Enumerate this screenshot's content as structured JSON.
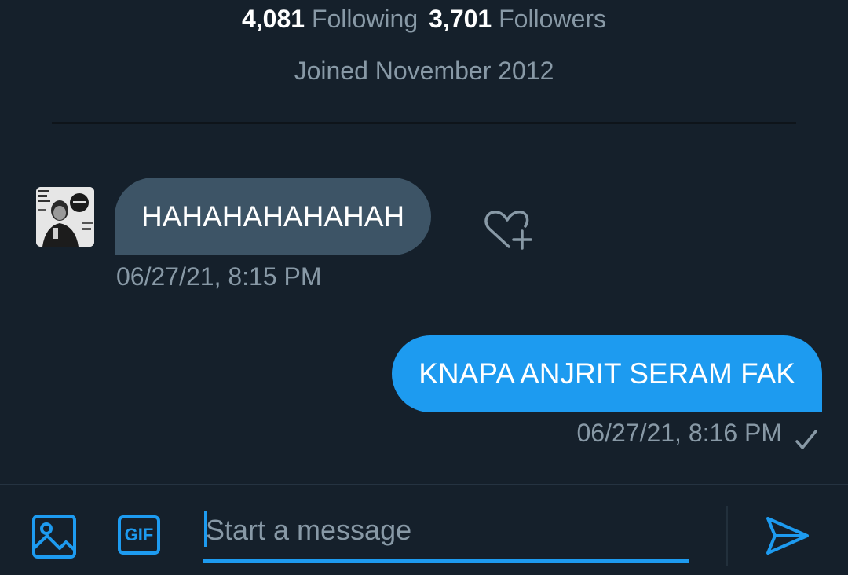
{
  "profile": {
    "following_count": "4,081",
    "following_label": "Following",
    "followers_count": "3,701",
    "followers_label": "Followers",
    "joined": "Joined November 2012"
  },
  "messages": [
    {
      "direction": "incoming",
      "text": "HAHAHAHAHAHAH",
      "time": "06/27/21, 8:15 PM"
    },
    {
      "direction": "outgoing",
      "text": "KNAPA ANJRIT SERAM FAK",
      "time": "06/27/21, 8:16 PM",
      "status_icon": "check-icon"
    }
  ],
  "composer": {
    "placeholder": "Start a message",
    "gif_label": "GIF",
    "icons": [
      "media-icon",
      "gif-icon",
      "send-icon"
    ]
  },
  "colors": {
    "background": "#15202b",
    "accent": "#1d9bf0",
    "incoming_bubble": "#3d5466",
    "secondary_text": "#8899a6"
  }
}
